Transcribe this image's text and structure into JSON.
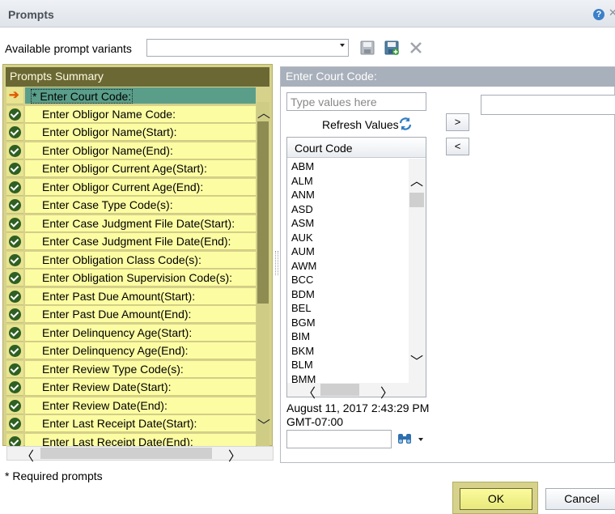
{
  "window": {
    "title": "Prompts",
    "help_icon": "?",
    "close_icon": "✕"
  },
  "variants": {
    "label": "Available prompt variants",
    "selected": ""
  },
  "summary": {
    "title": "Prompts Summary",
    "items": [
      {
        "label": "* Enter Court Code:",
        "status": "current"
      },
      {
        "label": "Enter Obligor Name Code:",
        "status": "done"
      },
      {
        "label": "Enter Obligor Name(Start):",
        "status": "done"
      },
      {
        "label": "Enter Obligor Name(End):",
        "status": "done"
      },
      {
        "label": "Enter Obligor Current Age(Start):",
        "status": "done"
      },
      {
        "label": "Enter Obligor Current Age(End):",
        "status": "done"
      },
      {
        "label": "Enter Case Type Code(s):",
        "status": "done"
      },
      {
        "label": "Enter Case Judgment File Date(Start):",
        "status": "done"
      },
      {
        "label": "Enter Case Judgment File Date(End):",
        "status": "done"
      },
      {
        "label": "Enter Obligation Class Code(s):",
        "status": "done"
      },
      {
        "label": "Enter Obligation Supervision Code(s):",
        "status": "done"
      },
      {
        "label": "Enter Past Due Amount(Start):",
        "status": "done"
      },
      {
        "label": "Enter Past Due Amount(End):",
        "status": "done"
      },
      {
        "label": "Enter Delinquency Age(Start):",
        "status": "done"
      },
      {
        "label": "Enter Delinquency Age(End):",
        "status": "done"
      },
      {
        "label": "Enter Review Type Code(s):",
        "status": "done"
      },
      {
        "label": "Enter Review Date(Start):",
        "status": "done"
      },
      {
        "label": "Enter Review Date(End):",
        "status": "done"
      },
      {
        "label": "Enter Last Receipt Date(Start):",
        "status": "done"
      },
      {
        "label": "Enter Last Receipt Date(End):",
        "status": "done"
      }
    ]
  },
  "court": {
    "title": "Enter Court Code:",
    "search_placeholder": "Type values here",
    "refresh_label": "Refresh Values",
    "add_label": ">",
    "remove_label": "<",
    "column_header": "Court Code",
    "values": [
      "ABM",
      "ALM",
      "ANM",
      "ASD",
      "ASM",
      "AUK",
      "AUM",
      "AWM",
      "BCC",
      "BDM",
      "BEL",
      "BGM",
      "BIM",
      "BKM",
      "BLM",
      "BMM"
    ],
    "timestamp_line1": "August 11, 2017 2:43:29 PM",
    "timestamp_line2": "GMT-07:00"
  },
  "footer": {
    "required_note": "* Required prompts",
    "ok_label": "OK",
    "cancel_label": "Cancel"
  },
  "colors": {
    "summary_bg": "#d6d28c",
    "summary_header": "#6b6834",
    "row_bg": "#fcfca3",
    "current_row": "#5a9e8a",
    "check": "#2e5f23",
    "right_header": "#a8b0bb"
  }
}
